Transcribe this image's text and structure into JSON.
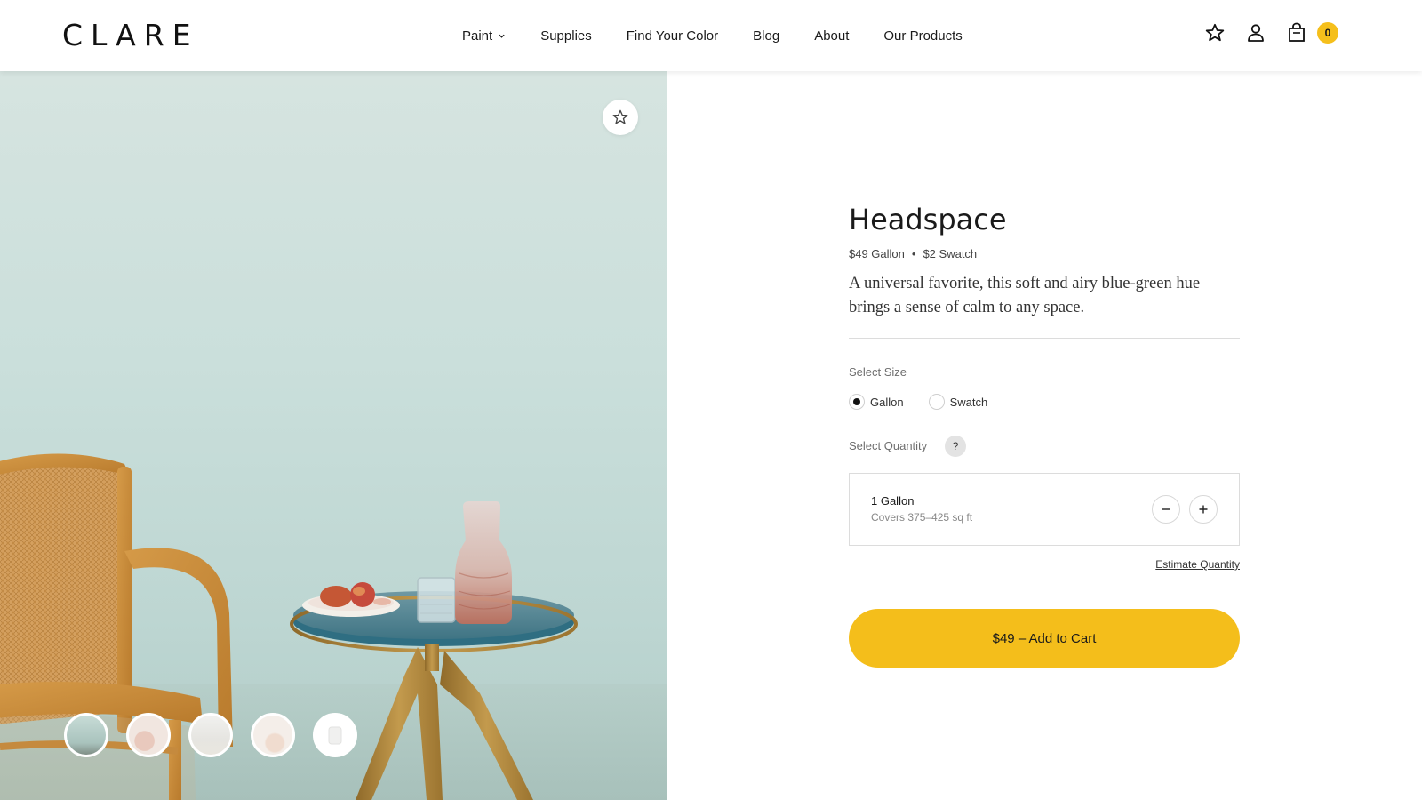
{
  "brand": {
    "logo": "CLARE"
  },
  "nav": {
    "items": [
      {
        "label": "Paint",
        "has_dropdown": true
      },
      {
        "label": "Supplies"
      },
      {
        "label": "Find Your Color"
      },
      {
        "label": "Blog"
      },
      {
        "label": "About"
      },
      {
        "label": "Our Products"
      }
    ]
  },
  "header": {
    "icons": [
      "star-icon",
      "user-icon",
      "cart-icon"
    ],
    "cart_count": "0"
  },
  "hero": {
    "wall_color": "#cadfdb",
    "thumbnails_count": 5
  },
  "product": {
    "title": "Headspace",
    "price_gallon": "$49 Gallon",
    "price_swatch": "$2 Swatch",
    "separator": "•",
    "description": "A universal favorite, this soft and airy blue-green hue brings a sense of calm to any space."
  },
  "size": {
    "label": "Select Size",
    "options": [
      "Gallon",
      "Swatch"
    ],
    "selected": "Gallon"
  },
  "quantity": {
    "label": "Select Quantity",
    "help": "?",
    "value": "1 Gallon",
    "coverage": "Covers 375–425 sq ft",
    "estimate_link": "Estimate Quantity"
  },
  "cta": {
    "label": "$49 – Add to Cart",
    "color": "#f4be1b"
  }
}
